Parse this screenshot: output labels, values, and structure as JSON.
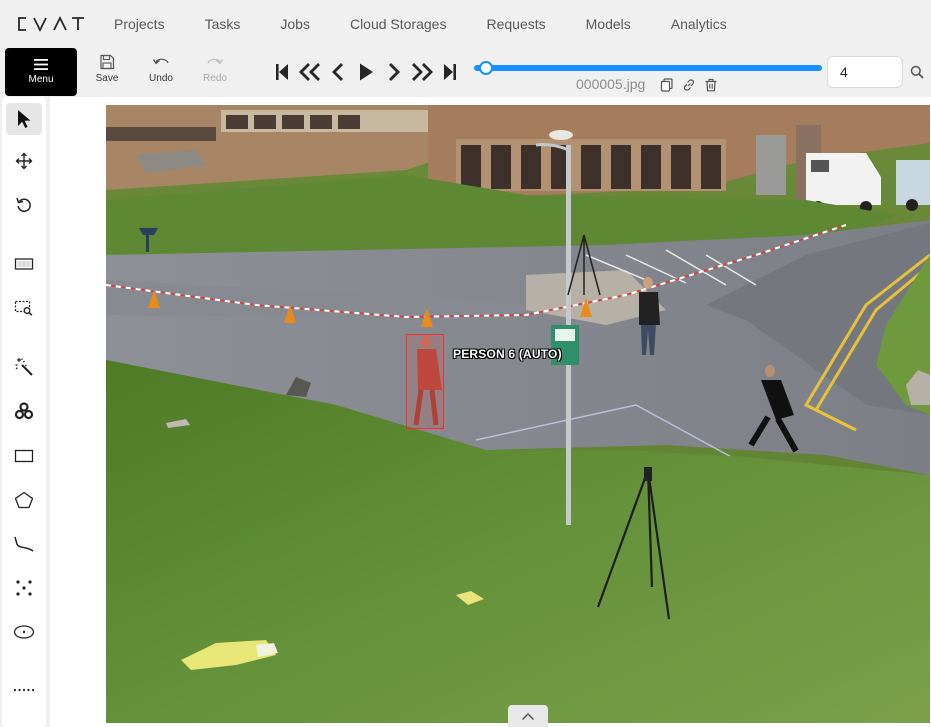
{
  "nav": {
    "items": [
      {
        "label": "Projects"
      },
      {
        "label": "Tasks"
      },
      {
        "label": "Jobs"
      },
      {
        "label": "Cloud Storages"
      },
      {
        "label": "Requests"
      },
      {
        "label": "Models"
      },
      {
        "label": "Analytics"
      }
    ]
  },
  "toolbar": {
    "menu_label": "Menu",
    "save_label": "Save",
    "undo_label": "Undo",
    "redo_label": "Redo"
  },
  "player": {
    "filename": "000005.jpg",
    "frame_number": "4"
  },
  "annotation": {
    "label": "PERSON 6 (AUTO)",
    "box_color": "#ff2b2b"
  },
  "colors": {
    "accent": "#1890ff",
    "menu_bg": "#000000",
    "background": "#f0f0f0"
  }
}
